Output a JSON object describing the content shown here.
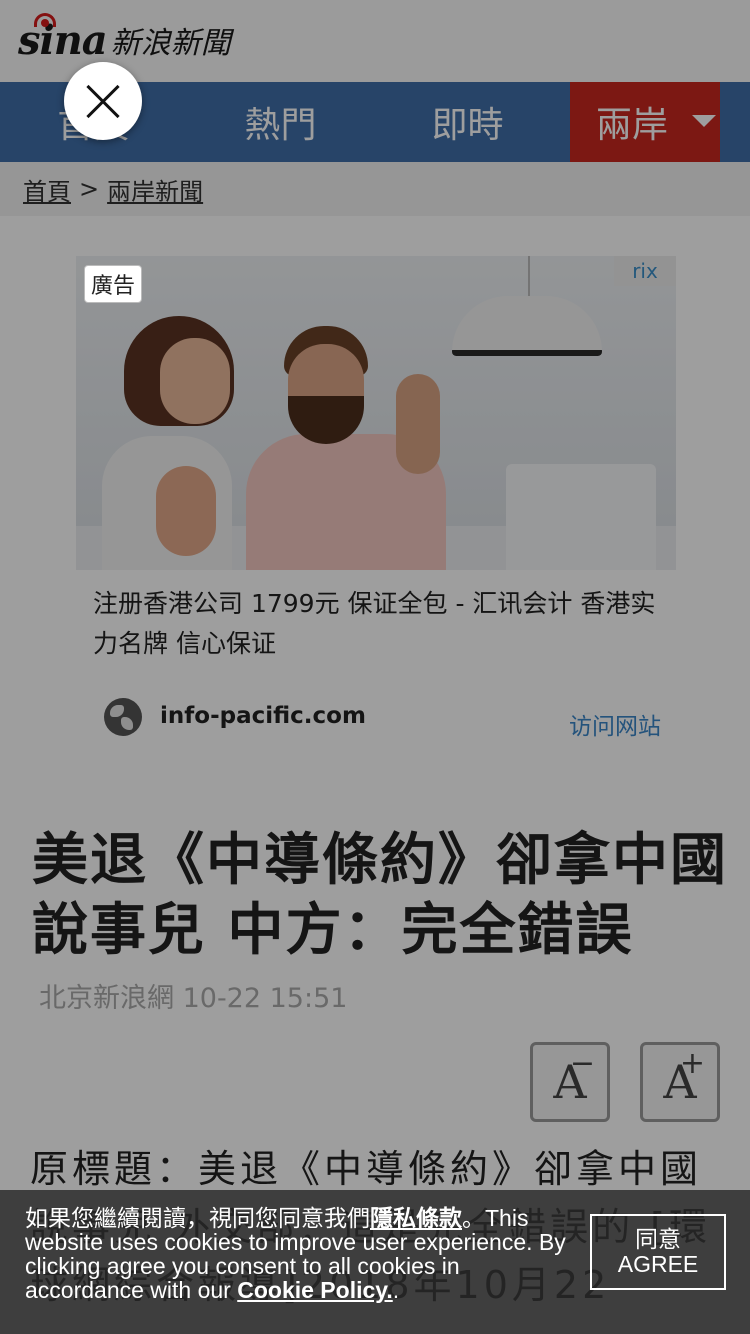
{
  "header": {
    "logo_text": "sina",
    "site_name": "新浪新聞"
  },
  "nav": {
    "items": [
      {
        "label": "首頁"
      },
      {
        "label": "熱門"
      },
      {
        "label": "即時"
      },
      {
        "label": "兩岸"
      }
    ],
    "active": "兩岸"
  },
  "breadcrumb": {
    "home": "首頁",
    "separator": ">",
    "section": "兩岸新聞"
  },
  "ad": {
    "tag": "廣告",
    "choice_label": "rix",
    "description": "注册香港公司 1799元 保证全包 - 汇讯会计 香港实力名牌 信心保证",
    "site": "info-pacific.com",
    "visit_label": "访问网站"
  },
  "article": {
    "title": "美退《中導條約》卻拿中國說事兒 中方：完全錯誤",
    "source_time": "北京新浪網 10-22 15:51",
    "font_decrease": "A",
    "font_decrease_sign": "−",
    "font_increase": "A",
    "font_increase_sign": "+",
    "body": "原標題：美退《中導條約》卻拿中國說事兒 外交部：這是完全錯誤的 [環球網綜合報導]2018年10月22"
  },
  "cookie": {
    "text_cn": "如果您繼續閱讀，視同您同意我們",
    "privacy_link": "隱私條款",
    "text_en": "。This website uses cookies to improve user experience. By clicking agree you consent to all cookies in accordance with our ",
    "policy_link": "Cookie Policy.",
    "end": ".",
    "agree_cn": "同意",
    "agree_en": "AGREE"
  },
  "icons": [
    "close-icon",
    "globe-icon",
    "dropdown-arrow-icon"
  ],
  "colors": {
    "nav_bg": "#3f6ea8",
    "nav_active": "#c9271f",
    "link_blue": "#3a86c8"
  }
}
